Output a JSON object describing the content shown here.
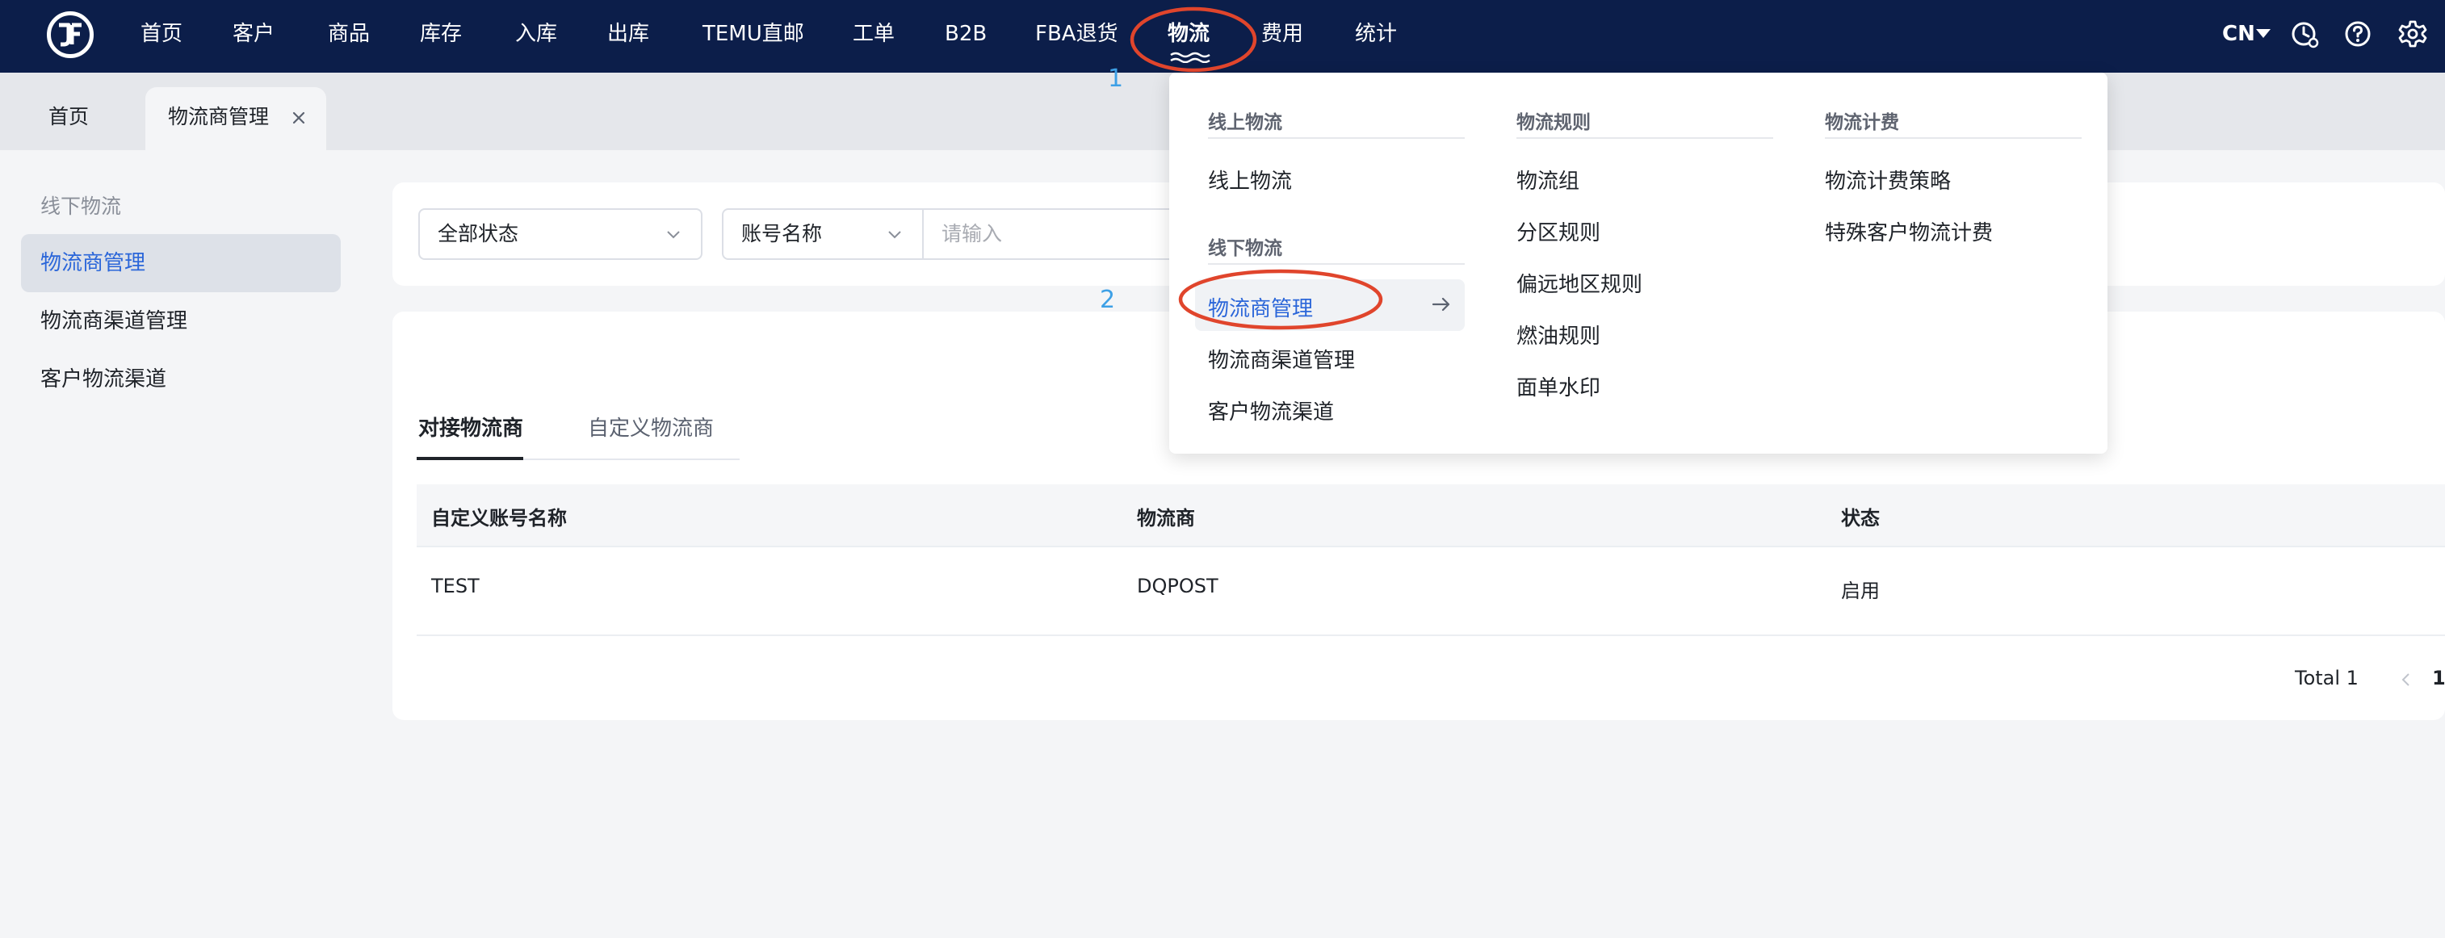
{
  "nav": {
    "items": [
      {
        "label": "首页"
      },
      {
        "label": "客户"
      },
      {
        "label": "商品"
      },
      {
        "label": "库存"
      },
      {
        "label": "入库"
      },
      {
        "label": "出库"
      },
      {
        "label": "TEMU直邮"
      },
      {
        "label": "工单"
      },
      {
        "label": "B2B"
      },
      {
        "label": "FBA退货"
      },
      {
        "label": "物流"
      },
      {
        "label": "费用"
      },
      {
        "label": "统计"
      }
    ],
    "active": "物流",
    "language": "CN",
    "icons": [
      "clock-icon",
      "help-icon",
      "gear-icon"
    ]
  },
  "tabs": {
    "home": "首页",
    "current": "物流商管理"
  },
  "sidebar": {
    "group": "线下物流",
    "items": [
      {
        "label": "物流商管理"
      },
      {
        "label": "物流商渠道管理"
      },
      {
        "label": "客户物流渠道"
      }
    ]
  },
  "filters": {
    "status": "全部状态",
    "field": "账号名称",
    "placeholder": "请输入"
  },
  "content": {
    "tabs": [
      {
        "label": "对接物流商"
      },
      {
        "label": "自定义物流商"
      }
    ],
    "table": {
      "columns": [
        "自定义账号名称",
        "物流商",
        "状态"
      ],
      "rows": [
        {
          "name": "TEST",
          "carrier": "DQPOST",
          "status": "启用"
        }
      ]
    },
    "pagination": {
      "total": "Total 1",
      "page": "1/"
    }
  },
  "dropdown": {
    "col1": {
      "head": "线上物流",
      "items": [
        "线上物流"
      ],
      "head2": "线下物流",
      "items2": [
        "物流商管理",
        "物流商渠道管理",
        "客户物流渠道"
      ]
    },
    "col2": {
      "head": "物流规则",
      "items": [
        "物流组",
        "分区规则",
        "偏远地区规则",
        "燃油规则",
        "面单水印"
      ]
    },
    "col3": {
      "head": "物流计费",
      "items": [
        "物流计费策略",
        "特殊客户物流计费"
      ]
    }
  },
  "annotations": {
    "step1": "1",
    "step2": "2",
    "color": "#e0452c"
  },
  "colors": {
    "nav_bg": "#0c1e4a",
    "accent": "#2b66d9",
    "annotation_number": "#3da0e6"
  }
}
